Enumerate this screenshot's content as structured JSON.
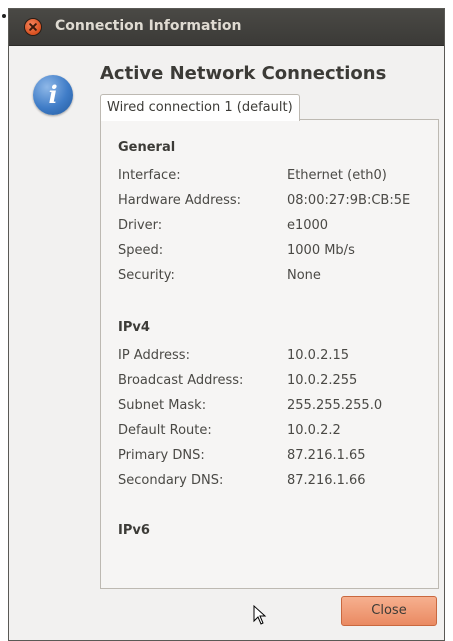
{
  "window": {
    "title": "Connection Information",
    "heading": "Active Network Connections"
  },
  "tab": {
    "label": "Wired connection 1 (default)"
  },
  "general": {
    "title": "General",
    "rows": [
      {
        "label": "Interface:",
        "value": "Ethernet (eth0)"
      },
      {
        "label": "Hardware Address:",
        "value": "08:00:27:9B:CB:5E"
      },
      {
        "label": "Driver:",
        "value": "e1000"
      },
      {
        "label": "Speed:",
        "value": "1000 Mb/s"
      },
      {
        "label": "Security:",
        "value": "None"
      }
    ]
  },
  "ipv4": {
    "title": "IPv4",
    "rows": [
      {
        "label": "IP Address:",
        "value": "10.0.2.15"
      },
      {
        "label": "Broadcast Address:",
        "value": "10.0.2.255"
      },
      {
        "label": "Subnet Mask:",
        "value": "255.255.255.0"
      },
      {
        "label": "Default Route:",
        "value": "10.0.2.2"
      },
      {
        "label": "Primary DNS:",
        "value": "87.216.1.65"
      },
      {
        "label": "Secondary DNS:",
        "value": "87.216.1.66"
      }
    ]
  },
  "ipv6": {
    "title": "IPv6"
  },
  "buttons": {
    "close_label": "Close"
  },
  "icons": {
    "window_close": "close-icon",
    "info": "info-icon",
    "cursor": "mouse-pointer-icon"
  },
  "colors": {
    "titlebar": "#3c3b37",
    "window_close": "#e0572a",
    "info_icon": "#3f7cc7",
    "close_button": "#ef9a72"
  }
}
